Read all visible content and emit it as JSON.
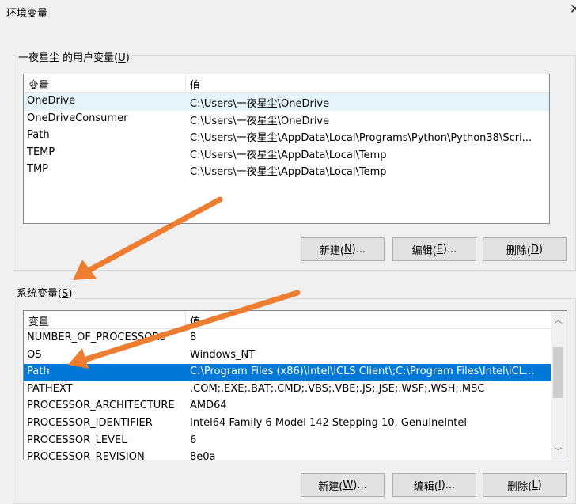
{
  "window": {
    "title": "环境变量",
    "close_glyph": "✕"
  },
  "user_vars": {
    "legend_text": "一夜星尘 的用户变量(",
    "legend_key": "U",
    "legend_end": ")",
    "col_name": "变量",
    "col_value": "值",
    "rows": [
      {
        "name": "OneDrive",
        "value": "C:\\Users\\一夜星尘\\OneDrive"
      },
      {
        "name": "OneDriveConsumer",
        "value": "C:\\Users\\一夜星尘\\OneDrive"
      },
      {
        "name": "Path",
        "value": "C:\\Users\\一夜星尘\\AppData\\Local\\Programs\\Python\\Python38\\Scri..."
      },
      {
        "name": "TEMP",
        "value": "C:\\Users\\一夜星尘\\AppData\\Local\\Temp"
      },
      {
        "name": "TMP",
        "value": "C:\\Users\\一夜星尘\\AppData\\Local\\Temp"
      }
    ],
    "buttons": {
      "new": {
        "text": "新建(",
        "key": "N",
        "end": ")..."
      },
      "edit": {
        "text": "编辑(",
        "key": "E",
        "end": ")..."
      },
      "delete": {
        "text": "删除(",
        "key": "D",
        "end": ")"
      }
    }
  },
  "system_vars": {
    "legend_text": "系统变量(",
    "legend_key": "S",
    "legend_end": ")",
    "col_name": "变量",
    "col_value": "值",
    "rows": [
      {
        "name": "NUMBER_OF_PROCESSORS",
        "value": "8"
      },
      {
        "name": "OS",
        "value": "Windows_NT"
      },
      {
        "name": "Path",
        "value": "C:\\Program Files (x86)\\Intel\\iCLS Client\\;C:\\Program Files\\Intel\\iCL..."
      },
      {
        "name": "PATHEXT",
        "value": ".COM;.EXE;.BAT;.CMD;.VBS;.VBE;.JS;.JSE;.WSF;.WSH;.MSC"
      },
      {
        "name": "PROCESSOR_ARCHITECTURE",
        "value": "AMD64"
      },
      {
        "name": "PROCESSOR_IDENTIFIER",
        "value": "Intel64 Family 6 Model 142 Stepping 10, GenuineIntel"
      },
      {
        "name": "PROCESSOR_LEVEL",
        "value": "6"
      },
      {
        "name": "PROCESSOR_REVISION",
        "value": "8e0a"
      }
    ],
    "buttons": {
      "new": {
        "text": "新建(",
        "key": "W",
        "end": ")..."
      },
      "edit": {
        "text": "编辑(",
        "key": "I",
        "end": ")..."
      },
      "delete": {
        "text": "删除(",
        "key": "L",
        "end": ")"
      }
    },
    "scroll_up_glyph": "︿",
    "scroll_down_glyph": "﹀"
  },
  "colors": {
    "selection": "#0078d7",
    "hover": "#e5f3fb",
    "annotation_arrow": "#ed7d31"
  }
}
